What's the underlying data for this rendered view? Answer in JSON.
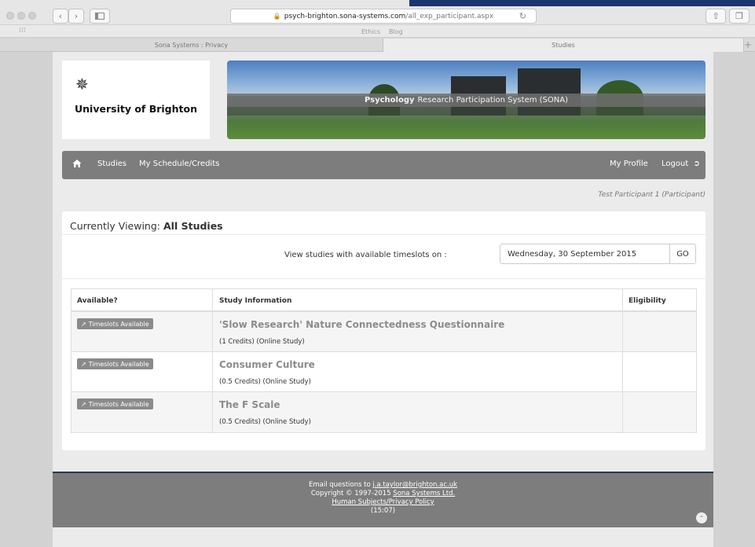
{
  "browser": {
    "url_host": "psych-brighton.sona-systems.com",
    "url_path": "/all_exp_participant.aspx",
    "bookmarks": [
      "Ethics",
      "Blog"
    ],
    "tabs": [
      {
        "label": "Sona Systems : Privacy",
        "active": false
      },
      {
        "label": "Studies",
        "active": true
      }
    ],
    "new_tab_label": "+"
  },
  "site": {
    "university_name": "University of Brighton",
    "banner_bold": "Psychology",
    "banner_rest": "Research Participation System (SONA)"
  },
  "nav": {
    "studies": "Studies",
    "schedule": "My Schedule/Credits",
    "profile": "My Profile",
    "logout": "Logout"
  },
  "user": "Test Participant 1 (Participant)",
  "viewing": {
    "label": "Currently Viewing:",
    "value": "All Studies"
  },
  "date_filter": {
    "label": "View studies with available timeslots on :",
    "value": "Wednesday, 30 September 2015",
    "go": "GO"
  },
  "table": {
    "headers": [
      "Available?",
      "Study Information",
      "Eligibility"
    ],
    "rows": [
      {
        "badge": "Timeslots Available",
        "title": "'Slow Research' Nature Connectedness Questionnaire",
        "meta": "(1 Credits) (Online Study)",
        "eligibility": ""
      },
      {
        "badge": "Timeslots Available",
        "title": "Consumer Culture",
        "meta": "(0.5 Credits) (Online Study)",
        "eligibility": ""
      },
      {
        "badge": "Timeslots Available",
        "title": "The F Scale",
        "meta": "(0.5 Credits) (Online Study)",
        "eligibility": ""
      }
    ]
  },
  "footer": {
    "email_prefix": "Email questions to",
    "email": "j.a.taylor@brighton.ac.uk",
    "copyright_prefix": "Copyright © 1997-2015",
    "company": "Sona Systems Ltd.",
    "policy": "Human Subjects/Privacy Policy",
    "time": "(15:07)"
  }
}
